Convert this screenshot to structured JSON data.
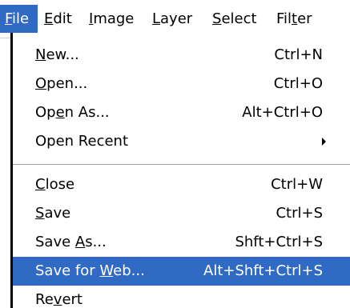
{
  "menubar": {
    "items": [
      {
        "before": "",
        "key": "F",
        "after": "ile"
      },
      {
        "before": "",
        "key": "E",
        "after": "dit"
      },
      {
        "before": "",
        "key": "I",
        "after": "mage"
      },
      {
        "before": "",
        "key": "L",
        "after": "ayer"
      },
      {
        "before": "",
        "key": "S",
        "after": "elect"
      },
      {
        "before": "Fil",
        "key": "t",
        "after": "er"
      }
    ]
  },
  "file_menu": {
    "items": [
      {
        "before": "",
        "key": "N",
        "after": "ew...",
        "shortcut": "Ctrl+N"
      },
      {
        "before": "",
        "key": "O",
        "after": "pen...",
        "shortcut": "Ctrl+O"
      },
      {
        "before": "Op",
        "key": "e",
        "after": "n As...",
        "shortcut": "Alt+Ctrl+O"
      },
      {
        "before": "Open Recent",
        "key": "",
        "after": "",
        "shortcut": ""
      },
      {
        "before": "",
        "key": "C",
        "after": "lose",
        "shortcut": "Ctrl+W"
      },
      {
        "before": "",
        "key": "S",
        "after": "ave",
        "shortcut": "Ctrl+S"
      },
      {
        "before": "Save ",
        "key": "A",
        "after": "s...",
        "shortcut": "Shft+Ctrl+S"
      },
      {
        "before": "Save for ",
        "key": "W",
        "after": "eb...",
        "shortcut": "Alt+Shft+Ctrl+S"
      },
      {
        "before": "Re",
        "key": "v",
        "after": "ert",
        "shortcut": ""
      }
    ],
    "selected_item": "Save for Web..."
  },
  "colors": {
    "highlight": "#316ac5",
    "highlight_text": "#ffffff",
    "menu_background": "#ffffff",
    "separator": "#a0a0a0"
  }
}
